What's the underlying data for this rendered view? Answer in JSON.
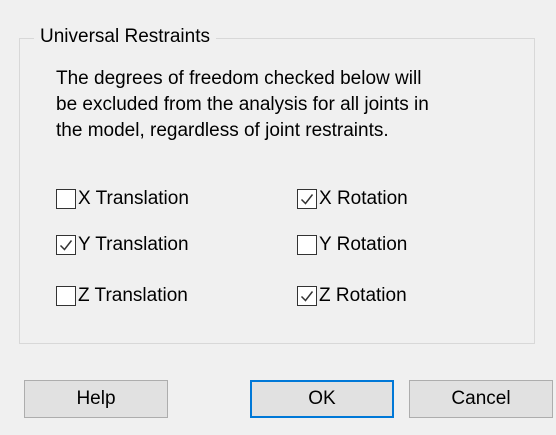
{
  "group": {
    "title": "Universal Restraints",
    "description_lines": [
      "The degrees of freedom checked below will",
      "be excluded from the analysis for all joints in",
      "the model, regardless of joint restraints."
    ]
  },
  "checkboxes": [
    {
      "label": "X Translation",
      "checked": false
    },
    {
      "label": "X Rotation",
      "checked": true
    },
    {
      "label": "Y Translation",
      "checked": true
    },
    {
      "label": "Y Rotation",
      "checked": false
    },
    {
      "label": "Z Translation",
      "checked": false
    },
    {
      "label": "Z Rotation",
      "checked": true
    }
  ],
  "buttons": {
    "help": "Help",
    "ok": "OK",
    "cancel": "Cancel"
  },
  "colors": {
    "background": "#f0f0f0",
    "button_face": "#e1e1e1",
    "default_button_border": "#0078d7",
    "check_mark": "#333333"
  }
}
